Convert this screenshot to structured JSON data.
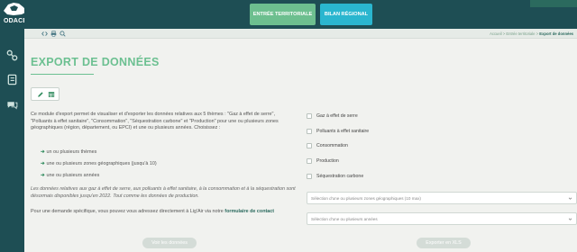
{
  "brand": {
    "name": "ODACE"
  },
  "header": {
    "territorial_label": "ENTRÉE TERRITORIALE",
    "bilan_label": "BILAN RÉGIONAL"
  },
  "breadcrumb": {
    "items": [
      "Accueil",
      "Entrée territoriale",
      "Export de données"
    ],
    "separator": ">"
  },
  "page": {
    "title": "EXPORT DE DONNÉES",
    "intro": "Ce module d'export permet de visualiser et d'exporter les données relatives aux 5 thèmes : \"Gaz à effet de serre\", \"Polluants à effet sanitaire\", \"Consommation\", \"Séquestration carbone\" et \"Production\" pour une ou plusieurs zones géographiques (région, département, ou EPCI) et une ou plusieurs années. Choisissez :",
    "bullets": [
      "un ou plusieurs thèmes",
      "une ou plusieurs zones géographiques (jusqu'à 10)",
      "une ou plusieurs années"
    ],
    "note": "Les données relatives aux gaz à effet de serre, aux polluants à effet sanitaire, à la consommation et à la séquestration sont désormais disponibles jusqu'en 2022. Tout comme les données de production.",
    "contact_prefix": "Pour une demande spécifique, vous pouvez vous adressez directement à Lig'Air via notre ",
    "contact_link": "formulaire de contact"
  },
  "themes": [
    "Gaz à effet de serre",
    "Polluants à effet sanitaire",
    "Consommation",
    "Production",
    "Séquestration carbone"
  ],
  "selects": {
    "zones_placeholder": "Sélection d'une ou plusieurs zones géographiques (10 max)",
    "years_placeholder": "Sélection d'une ou plusieurs années"
  },
  "actions": {
    "view_label": "Voir les données",
    "export_label": "Exporter en XLS"
  },
  "icons": {
    "sidebar": [
      "settings-flow-icon",
      "book-icon",
      "chat-icon"
    ],
    "subbar": [
      "code-icon",
      "print-icon",
      "zoom-icon"
    ],
    "tools": [
      "pencil-icon",
      "table-icon"
    ],
    "chevron": "chevron-down-icon"
  },
  "colors": {
    "sidebar": "#1e4e54",
    "accent_green": "#6cc091",
    "territorial_button": "#6dbf8f",
    "bilan_button": "#2ab6cf",
    "link": "#2b6a5e",
    "disabled_button": "#d4dcd7"
  }
}
